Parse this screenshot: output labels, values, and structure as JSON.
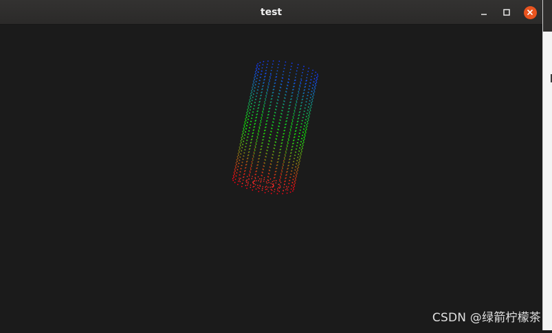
{
  "window": {
    "title": "test",
    "buttons": {
      "minimize": "minimize",
      "maximize": "maximize",
      "close": "close"
    },
    "close_color": "#e9541f"
  },
  "viewer": {
    "background": "#1b1b1b",
    "object": "point-cloud-cylinder",
    "color_gradient": [
      "#ff2020",
      "#20ff20",
      "#2020ff"
    ]
  },
  "watermark": "CSDN @绿箭柠檬茶"
}
